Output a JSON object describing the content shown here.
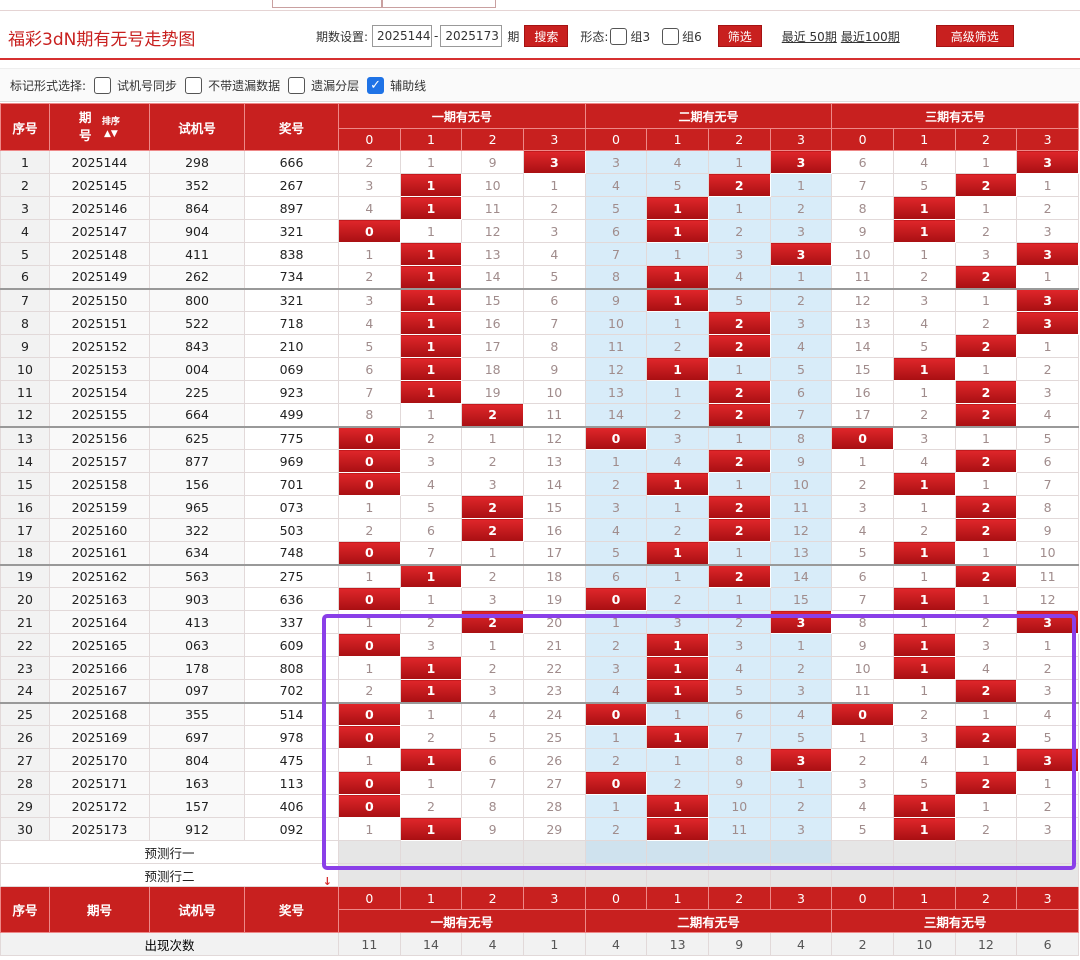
{
  "title": "福彩3dN期有无号走势图",
  "controls": {
    "period_label": "期数设置:",
    "period_from": "2025144",
    "period_sep": "-",
    "period_to": "2025173",
    "period_unit": "期",
    "search_label": "搜索",
    "shape_label": "形态:",
    "group3_label": "组3",
    "group6_label": "组6",
    "filter_label": "筛选",
    "recent50": "最近 50期",
    "recent100": "最近100期",
    "advanced_label": "高级筛选"
  },
  "options": {
    "label": "标记形式选择:",
    "items": [
      {
        "label": "试机号同步",
        "checked": false
      },
      {
        "label": "不带遗漏数据",
        "checked": false
      },
      {
        "label": "遗漏分层",
        "checked": false
      },
      {
        "label": "辅助线",
        "checked": true
      }
    ]
  },
  "header": {
    "col_index": "序号",
    "col_period": "期\n号",
    "sort_label": "排序",
    "col_trial": "试机号",
    "col_prize": "奖号",
    "groups": [
      "一期有无号",
      "二期有无号",
      "三期有无号"
    ],
    "sub": [
      "0",
      "1",
      "2",
      "3"
    ]
  },
  "rows": [
    {
      "i": "1",
      "p": "2025144",
      "t": "298",
      "w": "666",
      "c": [
        "2",
        "1",
        "9",
        "3",
        "3",
        "4",
        "1",
        "3",
        "6",
        "4",
        "1",
        "3"
      ],
      "h": [
        3,
        7,
        11
      ]
    },
    {
      "i": "2",
      "p": "2025145",
      "t": "352",
      "w": "267",
      "c": [
        "3",
        "1",
        "10",
        "1",
        "4",
        "5",
        "2",
        "1",
        "7",
        "5",
        "2",
        "1"
      ],
      "h": [
        1,
        6,
        10
      ]
    },
    {
      "i": "3",
      "p": "2025146",
      "t": "864",
      "w": "897",
      "c": [
        "4",
        "1",
        "11",
        "2",
        "5",
        "1",
        "1",
        "2",
        "8",
        "1",
        "1",
        "2"
      ],
      "h": [
        1,
        5,
        9
      ]
    },
    {
      "i": "4",
      "p": "2025147",
      "t": "904",
      "w": "321",
      "c": [
        "0",
        "1",
        "12",
        "3",
        "6",
        "1",
        "2",
        "3",
        "9",
        "1",
        "2",
        "3"
      ],
      "h": [
        0,
        5,
        9
      ]
    },
    {
      "i": "5",
      "p": "2025148",
      "t": "411",
      "w": "838",
      "c": [
        "1",
        "1",
        "13",
        "4",
        "7",
        "1",
        "3",
        "3",
        "10",
        "1",
        "3",
        "3"
      ],
      "h": [
        1,
        7,
        11
      ]
    },
    {
      "i": "6",
      "p": "2025149",
      "t": "262",
      "w": "734",
      "c": [
        "2",
        "1",
        "14",
        "5",
        "8",
        "1",
        "4",
        "1",
        "11",
        "2",
        "2",
        "1"
      ],
      "h": [
        1,
        5,
        10
      ]
    },
    {
      "i": "7",
      "p": "2025150",
      "t": "800",
      "w": "321",
      "c": [
        "3",
        "1",
        "15",
        "6",
        "9",
        "1",
        "5",
        "2",
        "12",
        "3",
        "1",
        "3"
      ],
      "h": [
        1,
        5,
        11
      ]
    },
    {
      "i": "8",
      "p": "2025151",
      "t": "522",
      "w": "718",
      "c": [
        "4",
        "1",
        "16",
        "7",
        "10",
        "1",
        "2",
        "3",
        "13",
        "4",
        "2",
        "3"
      ],
      "h": [
        1,
        6,
        11
      ]
    },
    {
      "i": "9",
      "p": "2025152",
      "t": "843",
      "w": "210",
      "c": [
        "5",
        "1",
        "17",
        "8",
        "11",
        "2",
        "2",
        "4",
        "14",
        "5",
        "2",
        "1"
      ],
      "h": [
        1,
        6,
        10
      ]
    },
    {
      "i": "10",
      "p": "2025153",
      "t": "004",
      "w": "069",
      "c": [
        "6",
        "1",
        "18",
        "9",
        "12",
        "1",
        "1",
        "5",
        "15",
        "1",
        "1",
        "2"
      ],
      "h": [
        1,
        5,
        9
      ]
    },
    {
      "i": "11",
      "p": "2025154",
      "t": "225",
      "w": "923",
      "c": [
        "7",
        "1",
        "19",
        "10",
        "13",
        "1",
        "2",
        "6",
        "16",
        "1",
        "2",
        "3"
      ],
      "h": [
        1,
        6,
        10
      ]
    },
    {
      "i": "12",
      "p": "2025155",
      "t": "664",
      "w": "499",
      "c": [
        "8",
        "1",
        "2",
        "11",
        "14",
        "2",
        "2",
        "7",
        "17",
        "2",
        "2",
        "4"
      ],
      "h": [
        2,
        6,
        10
      ]
    },
    {
      "i": "13",
      "p": "2025156",
      "t": "625",
      "w": "775",
      "c": [
        "0",
        "2",
        "1",
        "12",
        "0",
        "3",
        "1",
        "8",
        "0",
        "3",
        "1",
        "5"
      ],
      "h": [
        0,
        4,
        8
      ]
    },
    {
      "i": "14",
      "p": "2025157",
      "t": "877",
      "w": "969",
      "c": [
        "0",
        "3",
        "2",
        "13",
        "1",
        "4",
        "2",
        "9",
        "1",
        "4",
        "2",
        "6"
      ],
      "h": [
        0,
        6,
        10
      ]
    },
    {
      "i": "15",
      "p": "2025158",
      "t": "156",
      "w": "701",
      "c": [
        "0",
        "4",
        "3",
        "14",
        "2",
        "1",
        "1",
        "10",
        "2",
        "1",
        "1",
        "7"
      ],
      "h": [
        0,
        5,
        9
      ]
    },
    {
      "i": "16",
      "p": "2025159",
      "t": "965",
      "w": "073",
      "c": [
        "1",
        "5",
        "2",
        "15",
        "3",
        "1",
        "2",
        "11",
        "3",
        "1",
        "2",
        "8"
      ],
      "h": [
        2,
        6,
        10
      ]
    },
    {
      "i": "17",
      "p": "2025160",
      "t": "322",
      "w": "503",
      "c": [
        "2",
        "6",
        "2",
        "16",
        "4",
        "2",
        "2",
        "12",
        "4",
        "2",
        "2",
        "9"
      ],
      "h": [
        2,
        6,
        10
      ]
    },
    {
      "i": "18",
      "p": "2025161",
      "t": "634",
      "w": "748",
      "c": [
        "0",
        "7",
        "1",
        "17",
        "5",
        "1",
        "1",
        "13",
        "5",
        "1",
        "1",
        "10"
      ],
      "h": [
        0,
        5,
        9
      ]
    },
    {
      "i": "19",
      "p": "2025162",
      "t": "563",
      "w": "275",
      "c": [
        "1",
        "1",
        "2",
        "18",
        "6",
        "1",
        "2",
        "14",
        "6",
        "1",
        "2",
        "11"
      ],
      "h": [
        1,
        6,
        10
      ]
    },
    {
      "i": "20",
      "p": "2025163",
      "t": "903",
      "w": "636",
      "c": [
        "0",
        "1",
        "3",
        "19",
        "0",
        "2",
        "1",
        "15",
        "7",
        "1",
        "1",
        "12"
      ],
      "h": [
        0,
        4,
        9
      ]
    },
    {
      "i": "21",
      "p": "2025164",
      "t": "413",
      "w": "337",
      "c": [
        "1",
        "2",
        "2",
        "20",
        "1",
        "3",
        "2",
        "3",
        "8",
        "1",
        "2",
        "3"
      ],
      "h": [
        2,
        7,
        11
      ]
    },
    {
      "i": "22",
      "p": "2025165",
      "t": "063",
      "w": "609",
      "c": [
        "0",
        "3",
        "1",
        "21",
        "2",
        "1",
        "3",
        "1",
        "9",
        "1",
        "3",
        "1"
      ],
      "h": [
        0,
        5,
        9
      ]
    },
    {
      "i": "23",
      "p": "2025166",
      "t": "178",
      "w": "808",
      "c": [
        "1",
        "1",
        "2",
        "22",
        "3",
        "1",
        "4",
        "2",
        "10",
        "1",
        "4",
        "2"
      ],
      "h": [
        1,
        5,
        9
      ]
    },
    {
      "i": "24",
      "p": "2025167",
      "t": "097",
      "w": "702",
      "c": [
        "2",
        "1",
        "3",
        "23",
        "4",
        "1",
        "5",
        "3",
        "11",
        "1",
        "2",
        "3"
      ],
      "h": [
        1,
        5,
        10
      ]
    },
    {
      "i": "25",
      "p": "2025168",
      "t": "355",
      "w": "514",
      "c": [
        "0",
        "1",
        "4",
        "24",
        "0",
        "1",
        "6",
        "4",
        "0",
        "2",
        "1",
        "4"
      ],
      "h": [
        0,
        4,
        8
      ]
    },
    {
      "i": "26",
      "p": "2025169",
      "t": "697",
      "w": "978",
      "c": [
        "0",
        "2",
        "5",
        "25",
        "1",
        "1",
        "7",
        "5",
        "1",
        "3",
        "2",
        "5"
      ],
      "h": [
        0,
        5,
        10
      ]
    },
    {
      "i": "27",
      "p": "2025170",
      "t": "804",
      "w": "475",
      "c": [
        "1",
        "1",
        "6",
        "26",
        "2",
        "1",
        "8",
        "3",
        "2",
        "4",
        "1",
        "3"
      ],
      "h": [
        1,
        7,
        11
      ]
    },
    {
      "i": "28",
      "p": "2025171",
      "t": "163",
      "w": "113",
      "c": [
        "0",
        "1",
        "7",
        "27",
        "0",
        "2",
        "9",
        "1",
        "3",
        "5",
        "2",
        "1"
      ],
      "h": [
        0,
        4,
        10
      ]
    },
    {
      "i": "29",
      "p": "2025172",
      "t": "157",
      "w": "406",
      "c": [
        "0",
        "2",
        "8",
        "28",
        "1",
        "1",
        "10",
        "2",
        "4",
        "1",
        "1",
        "2"
      ],
      "h": [
        0,
        5,
        9
      ]
    },
    {
      "i": "30",
      "p": "2025173",
      "t": "912",
      "w": "092",
      "c": [
        "1",
        "1",
        "9",
        "29",
        "2",
        "1",
        "11",
        "3",
        "5",
        "1",
        "2",
        "3"
      ],
      "h": [
        1,
        5,
        9
      ]
    }
  ],
  "predict": {
    "row1": "预测行一",
    "row2": "预测行二",
    "arrow": "↓"
  },
  "footer": {
    "col_index": "序号",
    "col_period": "期号",
    "col_trial": "试机号",
    "col_prize": "奖号",
    "stat_label": "出现次数",
    "stats": [
      "11",
      "14",
      "4",
      "1",
      "4",
      "13",
      "9",
      "4",
      "2",
      "10",
      "12",
      "6"
    ]
  },
  "colors": {
    "accent": "#c8201f",
    "light_blue": "#d8ecf9",
    "selection": "#8a3fe8"
  }
}
